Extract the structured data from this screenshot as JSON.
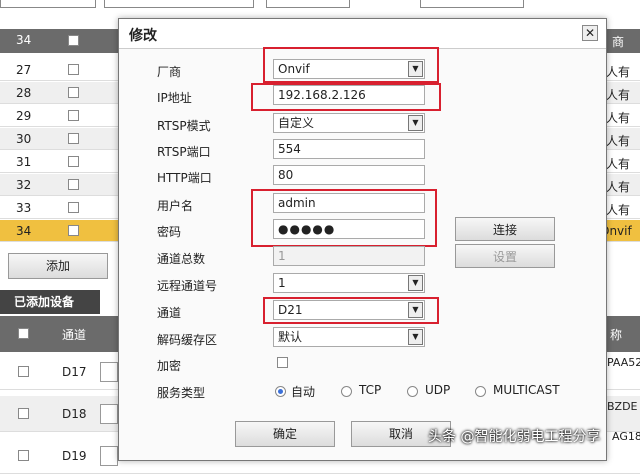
{
  "background": {
    "grid_header_right": "商",
    "rows": [
      {
        "num": "34",
        "right": ""
      },
      {
        "num": "27",
        "right": "人有"
      },
      {
        "num": "28",
        "right": "人有"
      },
      {
        "num": "29",
        "right": "人有"
      },
      {
        "num": "30",
        "right": "人有"
      },
      {
        "num": "31",
        "right": "人有"
      },
      {
        "num": "32",
        "right": "人有"
      },
      {
        "num": "33",
        "right": "人有"
      },
      {
        "num": "34",
        "right": "Onvif"
      }
    ],
    "add_button": "添加",
    "added_devices_tab": "已添加设备",
    "grid2_col_channel": "通道",
    "grid2_col_name": "称",
    "rows2": [
      {
        "channel": "D17",
        "right": "PAA52"
      },
      {
        "channel": "D18",
        "right": "BZDE"
      },
      {
        "channel": "D19",
        "right": "AG18"
      }
    ]
  },
  "dialog": {
    "title": "修改",
    "close_glyph": "✕",
    "labels": {
      "vendor": "厂商",
      "ip": "IP地址",
      "rtsp_mode": "RTSP模式",
      "rtsp_port": "RTSP端口",
      "http_port": "HTTP端口",
      "username": "用户名",
      "password": "密码",
      "channel_total": "通道总数",
      "remote_channel": "远程通道号",
      "channel": "通道",
      "decode_buffer": "解码缓存区",
      "encrypt": "加密",
      "service_type": "服务类型"
    },
    "values": {
      "vendor": "Onvif",
      "ip": "192.168.2.126",
      "rtsp_mode": "自定义",
      "rtsp_port": "554",
      "http_port": "80",
      "username": "admin",
      "password": "●●●●●",
      "channel_total": "1",
      "remote_channel": "1",
      "channel": "D21",
      "decode_buffer": "默认"
    },
    "service_options": [
      "自动",
      "TCP",
      "UDP",
      "MULTICAST"
    ],
    "service_selected": "自动",
    "connect_button": "连接",
    "settings_button": "设置",
    "ok_button": "确定",
    "cancel_button": "取消",
    "arrow_glyph": "▼"
  },
  "watermark": "头条 @智能化弱电工程分享",
  "colors": {
    "highlight": "#d8202f",
    "selected_row": "#f0c040",
    "header_gray": "#6b6b6b"
  }
}
